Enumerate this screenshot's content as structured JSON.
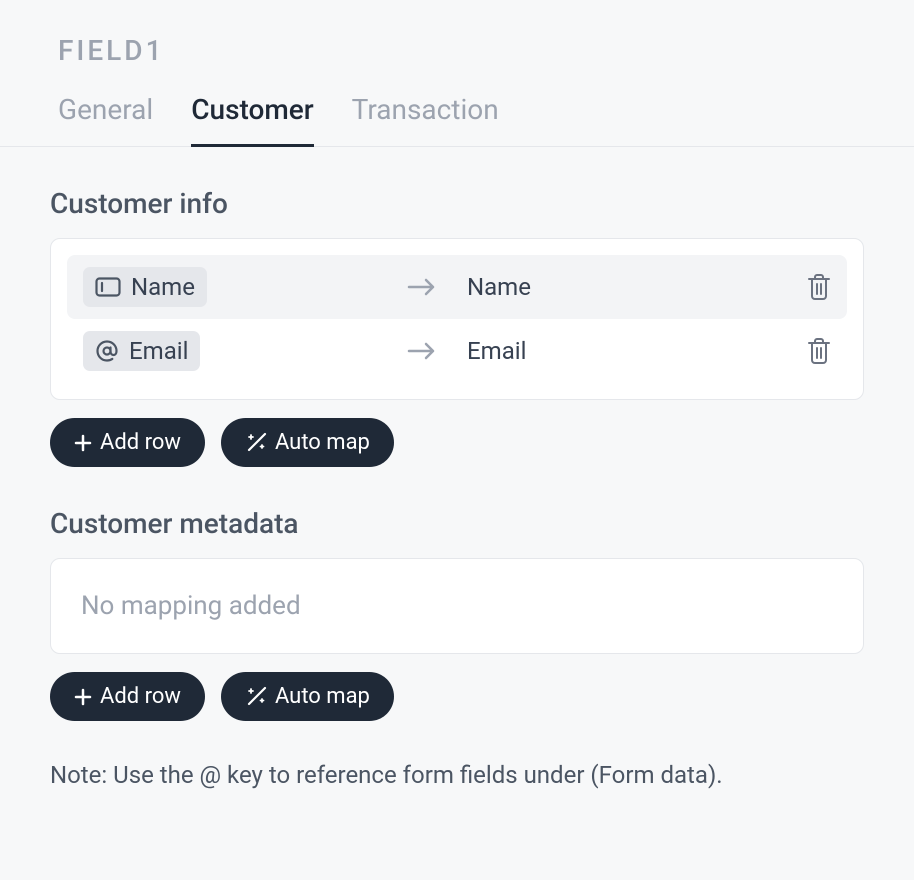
{
  "header": {
    "title": "FIELD1"
  },
  "tabs": [
    {
      "label": "General",
      "active": false
    },
    {
      "label": "Customer",
      "active": true
    },
    {
      "label": "Transaction",
      "active": false
    }
  ],
  "sections": {
    "customer_info": {
      "title": "Customer info",
      "rows": [
        {
          "icon": "text-input-icon",
          "source": "Name",
          "target": "Name",
          "highlighted": true
        },
        {
          "icon": "at-icon",
          "source": "Email",
          "target": "Email",
          "highlighted": false
        }
      ]
    },
    "customer_metadata": {
      "title": "Customer metadata",
      "empty_text": "No mapping added"
    }
  },
  "buttons": {
    "add_row": "Add row",
    "auto_map": "Auto map"
  },
  "note": "Note: Use the @ key to reference form fields under (Form data)."
}
